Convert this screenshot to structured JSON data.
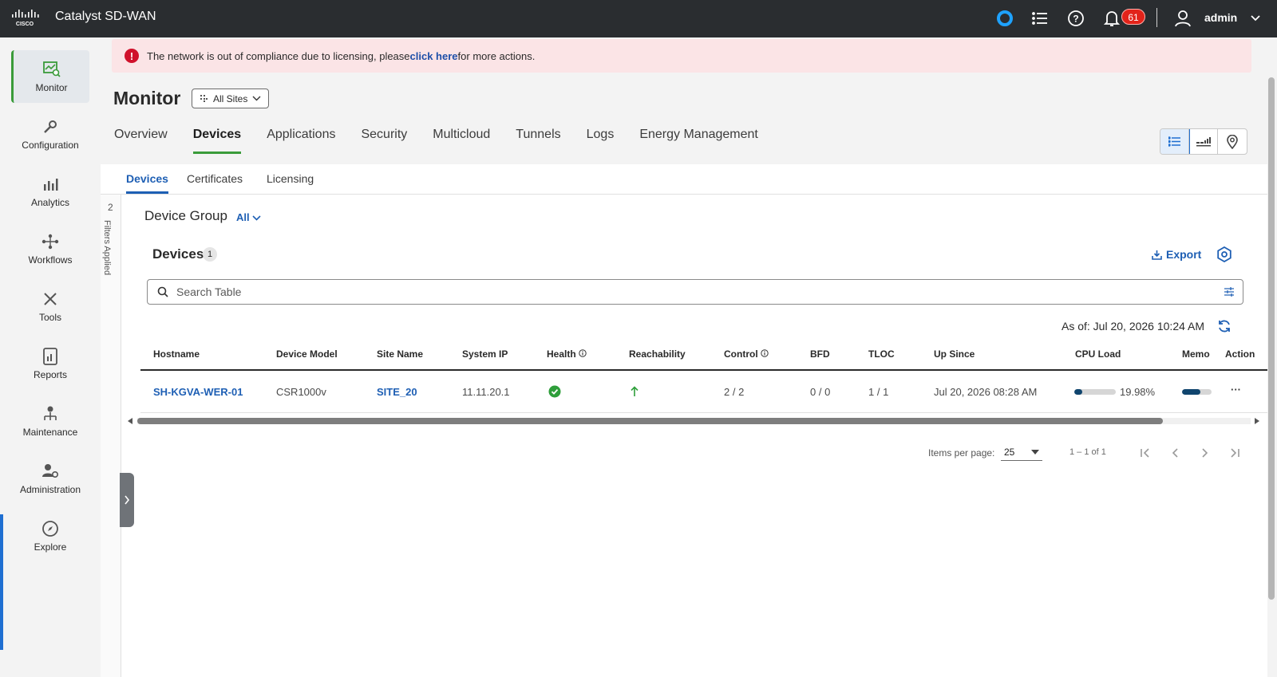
{
  "topbar": {
    "brand": "CISCO",
    "title": "Catalyst SD-WAN",
    "notification_count": "61",
    "user": "admin"
  },
  "nav": {
    "items": [
      {
        "label": "Monitor"
      },
      {
        "label": "Configuration"
      },
      {
        "label": "Analytics"
      },
      {
        "label": "Workflows"
      },
      {
        "label": "Tools"
      },
      {
        "label": "Reports"
      },
      {
        "label": "Maintenance"
      },
      {
        "label": "Administration"
      },
      {
        "label": "Explore"
      }
    ]
  },
  "banner": {
    "text_before": "The network is out of compliance due to licensing, please ",
    "link": "click here",
    "text_after": " for more actions."
  },
  "page": {
    "title": "Monitor",
    "site_filter": "All Sites"
  },
  "main_tabs": [
    "Overview",
    "Devices",
    "Applications",
    "Security",
    "Multicloud",
    "Tunnels",
    "Logs",
    "Energy Management"
  ],
  "sub_tabs": [
    "Devices",
    "Certificates",
    "Licensing"
  ],
  "filters": {
    "count": "2",
    "label": "Filters Applied"
  },
  "device_group": {
    "label": "Device Group",
    "value": "All"
  },
  "devices": {
    "title": "Devices",
    "count": "1",
    "export_label": "Export",
    "search_placeholder": "Search Table",
    "as_of": "As of: Jul 20, 2026 10:24 AM"
  },
  "table": {
    "columns": [
      "Hostname",
      "Device Model",
      "Site Name",
      "System IP",
      "Health",
      "Reachability",
      "Control",
      "BFD",
      "TLOC",
      "Up Since",
      "CPU Load",
      "Memo",
      "Action"
    ],
    "rows": [
      {
        "hostname": "SH-KGVA-WER-01",
        "model": "CSR1000v",
        "site": "SITE_20",
        "system_ip": "11.11.20.1",
        "health": "good",
        "reachability": "up",
        "control": "2 / 2",
        "bfd": "0 / 0",
        "tloc": "1 / 1",
        "up_since": "Jul 20, 2026 08:28 AM",
        "cpu_load": "19.98%",
        "cpu_fraction": 0.2,
        "memory_fraction": 0.62,
        "action": "···"
      }
    ]
  },
  "pagination": {
    "items_per_page_label": "Items per page:",
    "items_per_page": "25",
    "range": "1 – 1 of 1"
  },
  "colors": {
    "accent_green": "#3a9b3a",
    "link_blue": "#1e5fb4",
    "alert_red": "#d0112b"
  }
}
